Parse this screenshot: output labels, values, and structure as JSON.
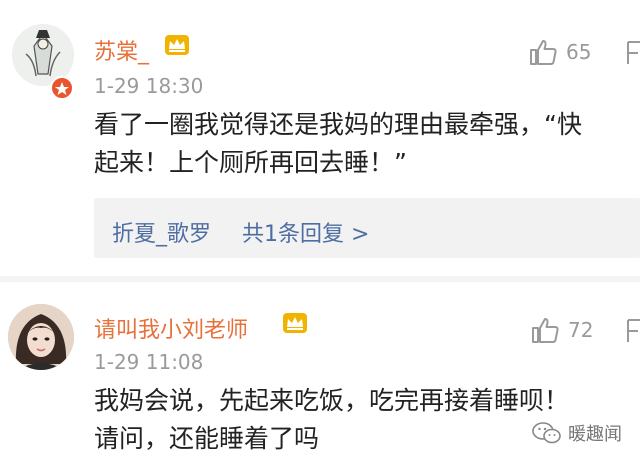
{
  "comments": [
    {
      "username": "苏棠_",
      "time": "1-29 18:30",
      "likes": "65",
      "text_lines": [
        "看了一圈我觉得还是我妈的理由最牵强，“快",
        "起来！上个厕所再回去睡！”"
      ],
      "reply": {
        "user": "折夏_歌罗",
        "summary": "共1条回复 >"
      }
    },
    {
      "username": "请叫我小刘老师",
      "time": "1-29 11:08",
      "likes": "72",
      "text_lines": [
        "我妈会说，先起来吃饭，吃完再接着睡呗！",
        "请问，还能睡着了吗"
      ]
    }
  ],
  "watermark": {
    "text": "暖趣闻"
  },
  "colors": {
    "username": "#e8703a",
    "link": "#4e6ea3",
    "meta": "#9a9a9a",
    "body": "#222222",
    "vip_badge": "#f0b400"
  }
}
